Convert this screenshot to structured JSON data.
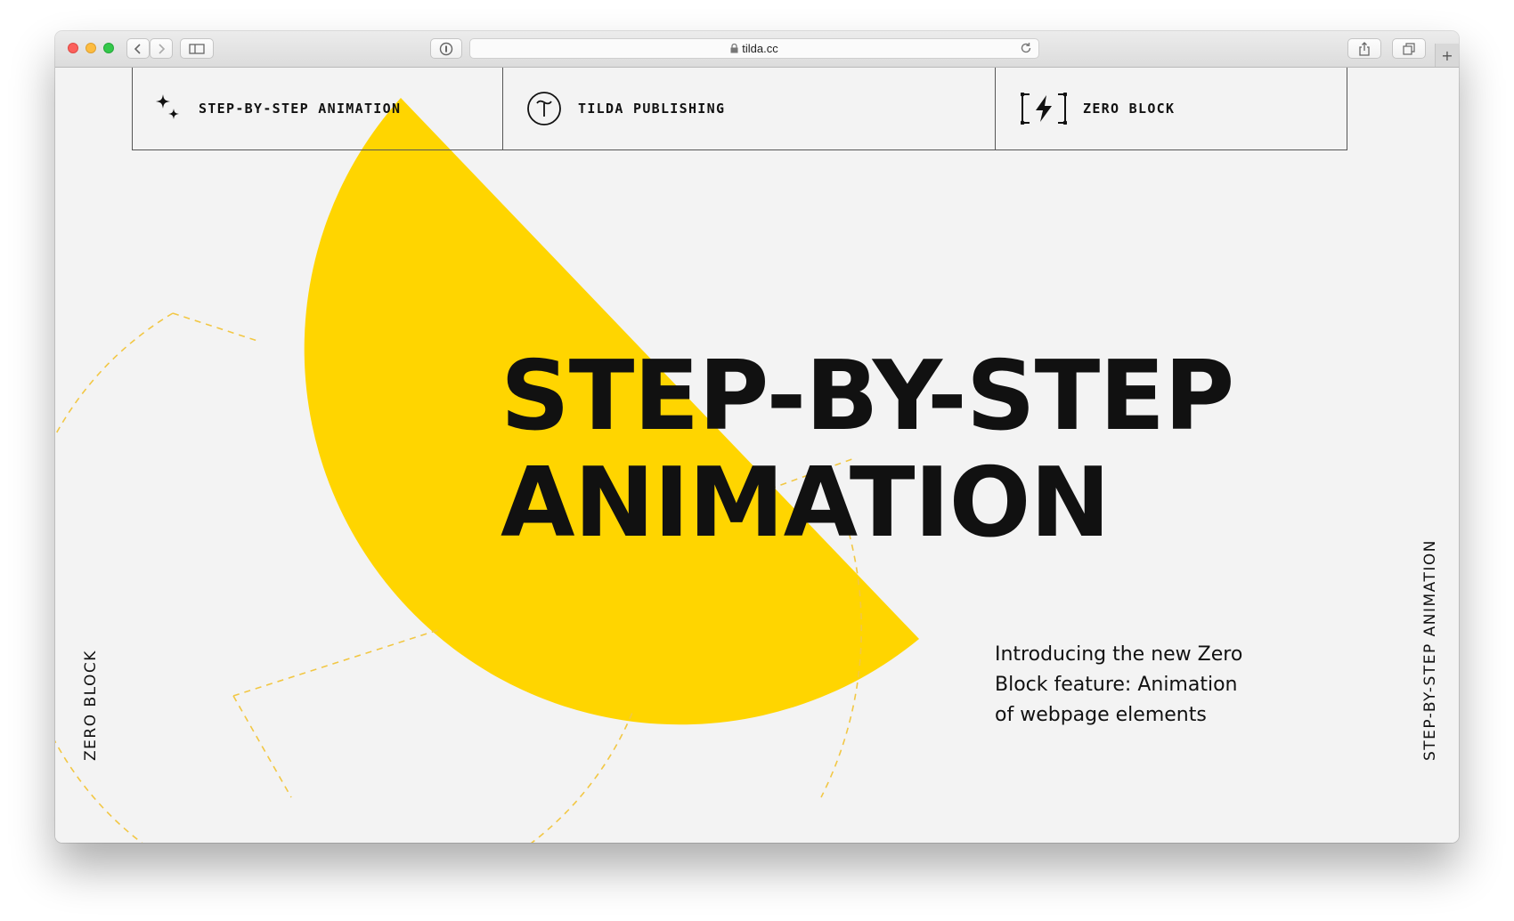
{
  "browser": {
    "url": "tilda.cc",
    "icons": [
      "back-icon",
      "forward-icon",
      "sidebar-icon",
      "reader-icon",
      "lock-icon",
      "reload-icon",
      "share-icon",
      "tabs-icon",
      "new-tab-icon"
    ]
  },
  "nav": {
    "items": [
      {
        "label": "STEP-BY-STEP ANIMATION",
        "icon": "sparkle-icon"
      },
      {
        "label": "TILDA PUBLISHING",
        "icon": "tilda-logo-icon"
      },
      {
        "label": "ZERO BLOCK",
        "icon": "zero-block-icon"
      }
    ]
  },
  "hero": {
    "line1": "STEP-BY-STEP",
    "line2": "ANIMATION"
  },
  "intro": {
    "line1": "Introducing the new Zero",
    "line2": "Block feature: Animation",
    "line3": "of webpage elements"
  },
  "side": {
    "left": "ZERO BLOCK",
    "right": "STEP-BY-STEP ANIMATION"
  },
  "colors": {
    "accent": "#FFD500",
    "text": "#111111",
    "background": "#F3F3F3"
  }
}
